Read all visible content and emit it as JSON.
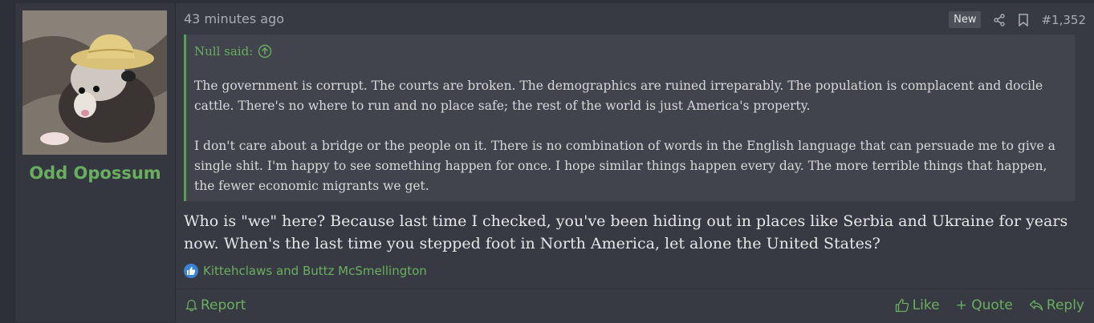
{
  "user": {
    "name": "Odd Opossum"
  },
  "post": {
    "time": "43 minutes ago",
    "badge": "New",
    "number": "#1,352",
    "quote": {
      "author": "Null said:",
      "paragraph1": "The government is corrupt. The courts are broken. The demographics are ruined irreparably. The population is complacent and docile cattle. There's no where to run and no place safe; the rest of the world is just America's property.",
      "paragraph2": "I don't care about a bridge or the people on it. There is no combination of words in the English language that can persuade me to give a single shit. I'm happy to see something happen for once. I hope similar things happen every day. The more terrible things that happen, the fewer economic migrants we get."
    },
    "message": "Who is \"we\" here? Because last time I checked, you've been hiding out in places like Serbia and Ukraine for years now. When's the last time you stepped foot in North America, let alone the United States?",
    "reactions": "Kittehclaws and Buttz McSmellington"
  },
  "footer": {
    "report": "Report",
    "like": "Like",
    "quote": "+ Quote",
    "reply": "Reply"
  },
  "icons": {
    "share": "share-icon",
    "bookmark": "bookmark-icon",
    "quote_up": "arrow-up-circle-icon",
    "like_reaction": "thumbs-up-icon",
    "report": "bell-icon",
    "like": "thumbs-up-icon",
    "reply": "reply-icon"
  },
  "colors": {
    "accent": "#6aaf5f",
    "background": "#373a42",
    "quote_bg": "#41444c",
    "reaction_blue": "#3b82d6"
  }
}
